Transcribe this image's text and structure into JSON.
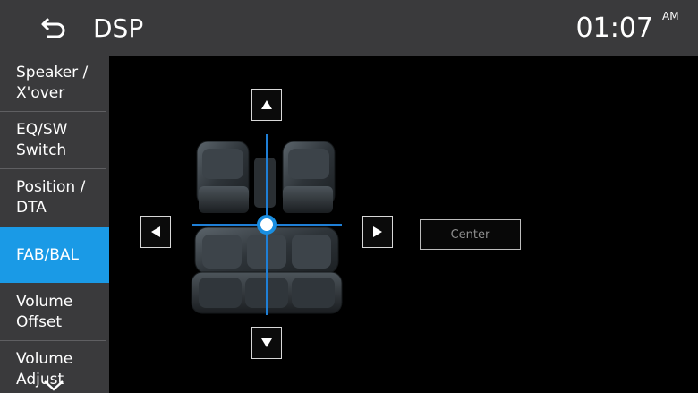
{
  "header": {
    "title": "DSP",
    "time": "01:07",
    "ampm": "AM",
    "back_icon": "back-arrow-icon"
  },
  "sidebar": {
    "items": [
      {
        "label": "Speaker /\nX'over",
        "active": false
      },
      {
        "label": "EQ/SW\nSwitch",
        "active": false
      },
      {
        "label": "Position /\nDTA",
        "active": false
      },
      {
        "label": "FAB/BAL",
        "active": true
      },
      {
        "label": "Volume\nOffset",
        "active": false
      },
      {
        "label": "Volume\nAdjust",
        "active": false
      }
    ],
    "scroll_icon": "chevron-down-icon"
  },
  "controls": {
    "up_icon": "triangle-up-icon",
    "down_icon": "triangle-down-icon",
    "left_icon": "triangle-left-icon",
    "right_icon": "triangle-right-icon",
    "center_label": "Center"
  },
  "colors": {
    "accent": "#1a9ae6",
    "header_bg": "#3a3a3c",
    "crosshair": "#1f7fd6"
  }
}
